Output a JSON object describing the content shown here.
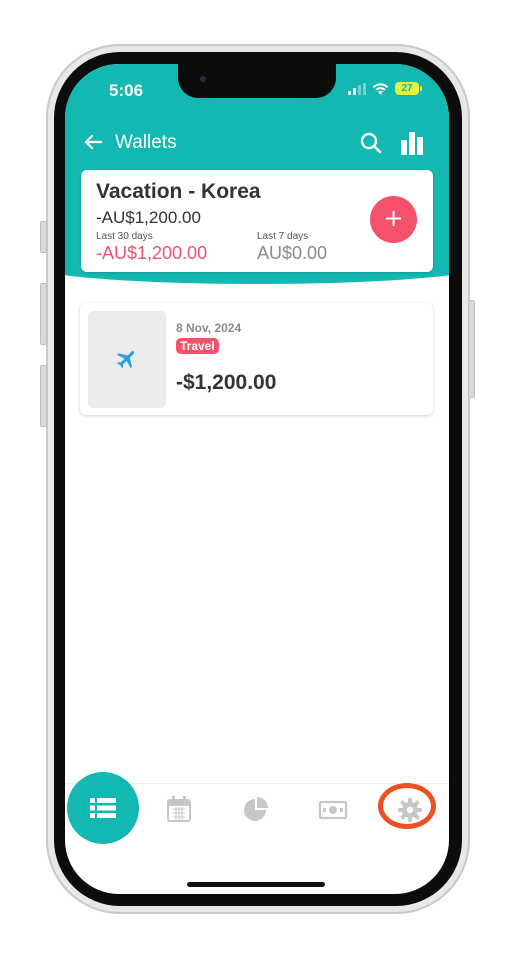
{
  "status_bar": {
    "time": "5:06",
    "battery": "27"
  },
  "toolbar": {
    "title": "Wallets"
  },
  "wallet": {
    "name": "Vacation - Korea",
    "balance": "-AU$1,200.00",
    "last_30_label": "Last 30 days",
    "last_30_value": "-AU$1,200.00",
    "last_7_label": "Last 7 days",
    "last_7_value": "AU$0.00",
    "add_label": "+"
  },
  "transactions": [
    {
      "date": "8 Nov, 2024",
      "category": "Travel",
      "amount": "-$1,200.00",
      "icon": "airplane-icon"
    }
  ],
  "bottom_nav": {
    "items": [
      "transactions-list",
      "calendar",
      "reports-pie",
      "budget-money",
      "settings"
    ],
    "active": "transactions-list",
    "highlighted": "settings"
  },
  "colors": {
    "primary": "#14b8b2",
    "accent": "#f5516b",
    "highlight": "#ee4f23",
    "negative": "#f5516b",
    "muted": "#8a8a8a"
  }
}
